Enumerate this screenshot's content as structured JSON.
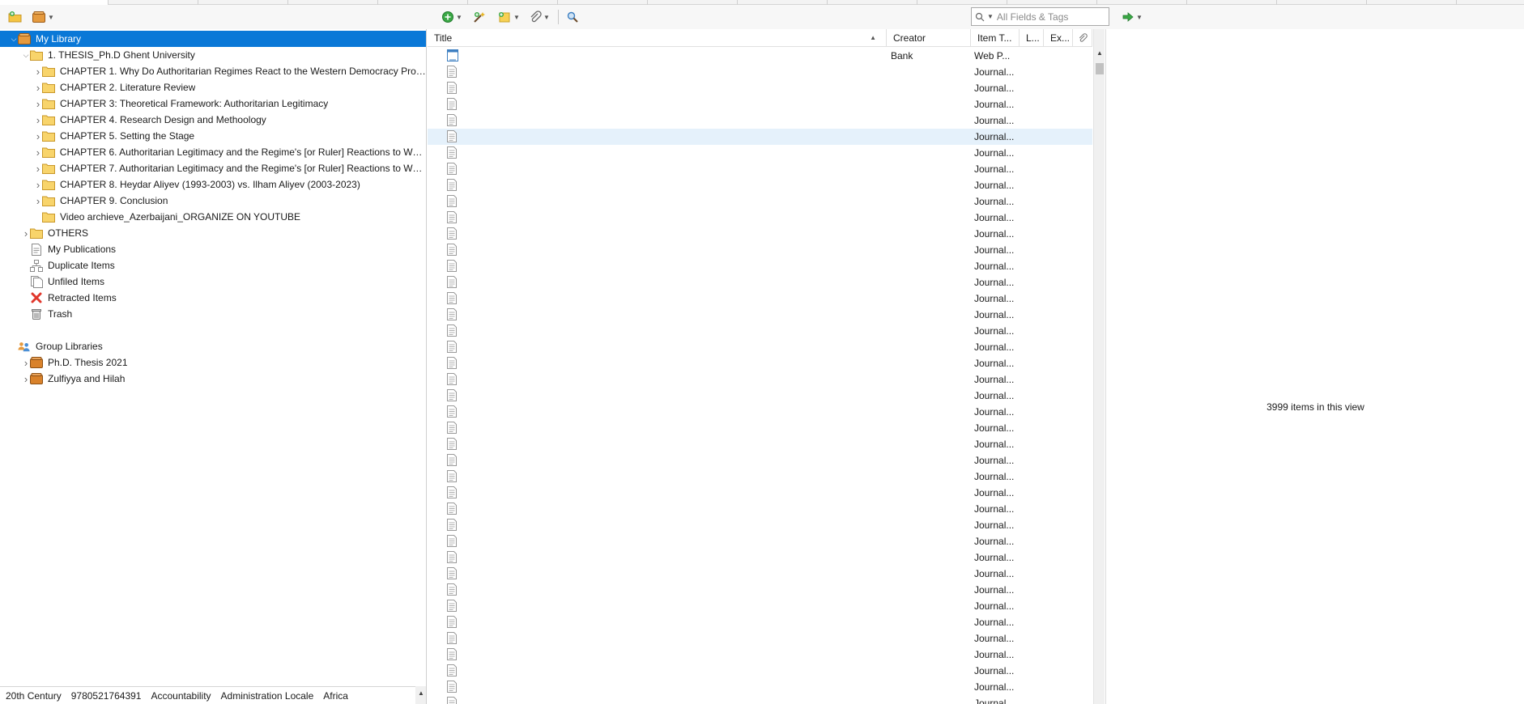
{
  "toolbar": {
    "search_placeholder": "All Fields & Tags"
  },
  "collections": [
    {
      "label": "My Library",
      "level": 0,
      "twisty": "expanded",
      "icon": "library-icon",
      "selected": true
    },
    {
      "label": "1. THESIS_Ph.D Ghent University",
      "level": 1,
      "twisty": "expanded",
      "icon": "folder-icon"
    },
    {
      "label": "CHAPTER 1. Why Do Authoritarian Regimes React to the Western Democracy Prom...",
      "level": 2,
      "twisty": "collapsed",
      "icon": "folder-icon"
    },
    {
      "label": "CHAPTER 2. Literature Review",
      "level": 2,
      "twisty": "collapsed",
      "icon": "folder-icon"
    },
    {
      "label": "CHAPTER 3: Theoretical Framework: Authoritarian Legitimacy",
      "level": 2,
      "twisty": "collapsed",
      "icon": "folder-icon"
    },
    {
      "label": "CHAPTER 4. Research Design and Methoology",
      "level": 2,
      "twisty": "collapsed",
      "icon": "folder-icon"
    },
    {
      "label": "CHAPTER 5. Setting the Stage",
      "level": 2,
      "twisty": "collapsed",
      "icon": "folder-icon"
    },
    {
      "label": "CHAPTER 6. Authoritarian Legitimacy and the Regime's [or Ruler] Reactions to West...",
      "level": 2,
      "twisty": "collapsed",
      "icon": "folder-icon"
    },
    {
      "label": "CHAPTER 7. Authoritarian Legitimacy and the Regime's [or Ruler] Reactions to West...",
      "level": 2,
      "twisty": "collapsed",
      "icon": "folder-icon"
    },
    {
      "label": "CHAPTER 8. Heydar Aliyev (1993-2003) vs. Ilham Aliyev (2003-2023)",
      "level": 2,
      "twisty": "collapsed",
      "icon": "folder-icon"
    },
    {
      "label": "CHAPTER 9. Conclusion",
      "level": 2,
      "twisty": "collapsed",
      "icon": "folder-icon"
    },
    {
      "label": "Video archieve_Azerbaijani_ORGANIZE ON YOUTUBE",
      "level": 2,
      "twisty": "none",
      "icon": "folder-icon"
    },
    {
      "label": "OTHERS",
      "level": 1,
      "twisty": "collapsed",
      "icon": "folder-icon"
    },
    {
      "label": "My Publications",
      "level": 1,
      "twisty": "none",
      "icon": "publications-icon"
    },
    {
      "label": "Duplicate Items",
      "level": 1,
      "twisty": "none",
      "icon": "duplicate-icon"
    },
    {
      "label": "Unfiled Items",
      "level": 1,
      "twisty": "none",
      "icon": "unfiled-icon"
    },
    {
      "label": "Retracted Items",
      "level": 1,
      "twisty": "none",
      "icon": "retracted-icon"
    },
    {
      "label": "Trash",
      "level": 1,
      "twisty": "none",
      "icon": "trash-icon"
    },
    {
      "label": "",
      "level": 0,
      "twisty": "none",
      "icon": "none"
    },
    {
      "label": "Group Libraries",
      "level": 0,
      "twisty": "none",
      "icon": "group-libraries-icon"
    },
    {
      "label": "Ph.D. Thesis 2021",
      "level": 1,
      "twisty": "collapsed",
      "icon": "group-library-icon"
    },
    {
      "label": "Zulfiyya and Hilah",
      "level": 1,
      "twisty": "collapsed",
      "icon": "group-library-icon"
    }
  ],
  "tags": [
    "20th Century",
    "9780521764391",
    "Accountability",
    "Administration Locale",
    "Africa"
  ],
  "columns": {
    "title": "Title",
    "creator": "Creator",
    "item_type": "Item T...",
    "col_l": "L...",
    "col_ex": "Ex..."
  },
  "items": [
    {
      "creator": "Bank",
      "type": "Web P..."
    },
    {
      "creator": "",
      "type": "Journal..."
    },
    {
      "creator": "",
      "type": "Journal..."
    },
    {
      "creator": "",
      "type": "Journal..."
    },
    {
      "creator": "",
      "type": "Journal..."
    },
    {
      "creator": "",
      "type": "Journal..."
    },
    {
      "creator": "",
      "type": "Journal..."
    },
    {
      "creator": "",
      "type": "Journal..."
    },
    {
      "creator": "",
      "type": "Journal..."
    },
    {
      "creator": "",
      "type": "Journal..."
    },
    {
      "creator": "",
      "type": "Journal..."
    },
    {
      "creator": "",
      "type": "Journal..."
    },
    {
      "creator": "",
      "type": "Journal..."
    },
    {
      "creator": "",
      "type": "Journal..."
    },
    {
      "creator": "",
      "type": "Journal..."
    },
    {
      "creator": "",
      "type": "Journal..."
    },
    {
      "creator": "",
      "type": "Journal..."
    },
    {
      "creator": "",
      "type": "Journal..."
    },
    {
      "creator": "",
      "type": "Journal..."
    },
    {
      "creator": "",
      "type": "Journal..."
    },
    {
      "creator": "",
      "type": "Journal..."
    },
    {
      "creator": "",
      "type": "Journal..."
    },
    {
      "creator": "",
      "type": "Journal..."
    },
    {
      "creator": "",
      "type": "Journal..."
    },
    {
      "creator": "",
      "type": "Journal..."
    },
    {
      "creator": "",
      "type": "Journal..."
    },
    {
      "creator": "",
      "type": "Journal..."
    },
    {
      "creator": "",
      "type": "Journal..."
    },
    {
      "creator": "",
      "type": "Journal..."
    },
    {
      "creator": "",
      "type": "Journal..."
    },
    {
      "creator": "",
      "type": "Journal..."
    },
    {
      "creator": "",
      "type": "Journal..."
    },
    {
      "creator": "",
      "type": "Journal..."
    },
    {
      "creator": "",
      "type": "Journal..."
    },
    {
      "creator": "",
      "type": "Journal..."
    },
    {
      "creator": "",
      "type": "Journal..."
    },
    {
      "creator": "",
      "type": "Journal..."
    },
    {
      "creator": "",
      "type": "Journal..."
    },
    {
      "creator": "",
      "type": "Journal..."
    },
    {
      "creator": "",
      "type": "Journal..."
    },
    {
      "creator": "",
      "type": "Journal..."
    },
    {
      "creator": "",
      "type": "Journal..."
    }
  ],
  "item_pane": {
    "message": "3999 items in this view"
  },
  "colors": {
    "selection": "#0a78d7",
    "hover_row": "#e5f1fb",
    "folder": "#f5c542"
  }
}
